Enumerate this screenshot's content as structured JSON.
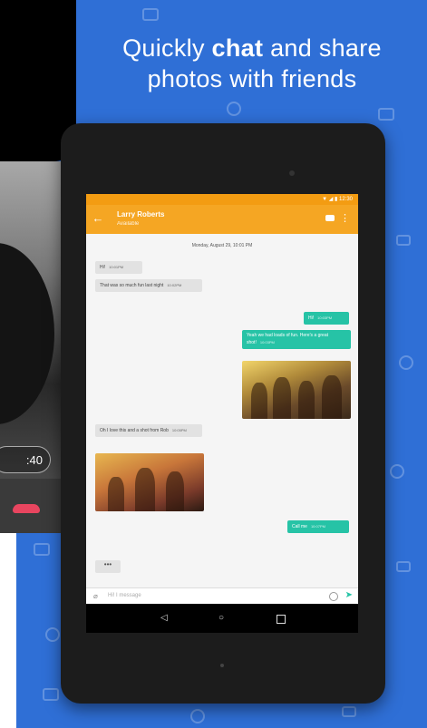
{
  "headline": {
    "line1_pre": "Quickly ",
    "line1_bold": "chat",
    "line1_post": " and share",
    "line2": "photos with friends"
  },
  "call": {
    "timer": ":40"
  },
  "app": {
    "status": "▼ ◢ ▮ 12:30",
    "contact_name": "Larry Roberts",
    "contact_status": "Available",
    "date_label": "Monday, August 29, 10:01 PM",
    "compose_placeholder": "Hi! I message"
  },
  "messages": [
    {
      "dir": "in",
      "text": "Hi!",
      "time": "10:01PM"
    },
    {
      "dir": "in",
      "text": "That was so much fun last night",
      "time": "10:02PM"
    },
    {
      "dir": "out",
      "text": "Hi!",
      "time": "10:03PM"
    },
    {
      "dir": "out",
      "text": "Yeah we had loads of fun. Here's a great shot!",
      "time": "10:03PM"
    },
    {
      "dir": "in",
      "text": "Oh I love this and a shot from Rob",
      "time": "10:05PM"
    },
    {
      "dir": "out",
      "text": "Call me",
      "time": "10:07PM"
    }
  ],
  "typing_indicator": "•••",
  "icons": {
    "back": "arrow-back-icon",
    "video": "video-call-icon",
    "more": "more-vert-icon",
    "attach": "attach-icon",
    "emoji": "emoji-icon",
    "send": "send-icon",
    "hangup": "hangup-icon"
  },
  "colors": {
    "promo_background": "#2f6fd6",
    "app_bar": "#f5a623",
    "outgoing_bubble": "#26c3a6",
    "incoming_bubble": "#e2e2e2",
    "hangup": "#e8455f"
  }
}
